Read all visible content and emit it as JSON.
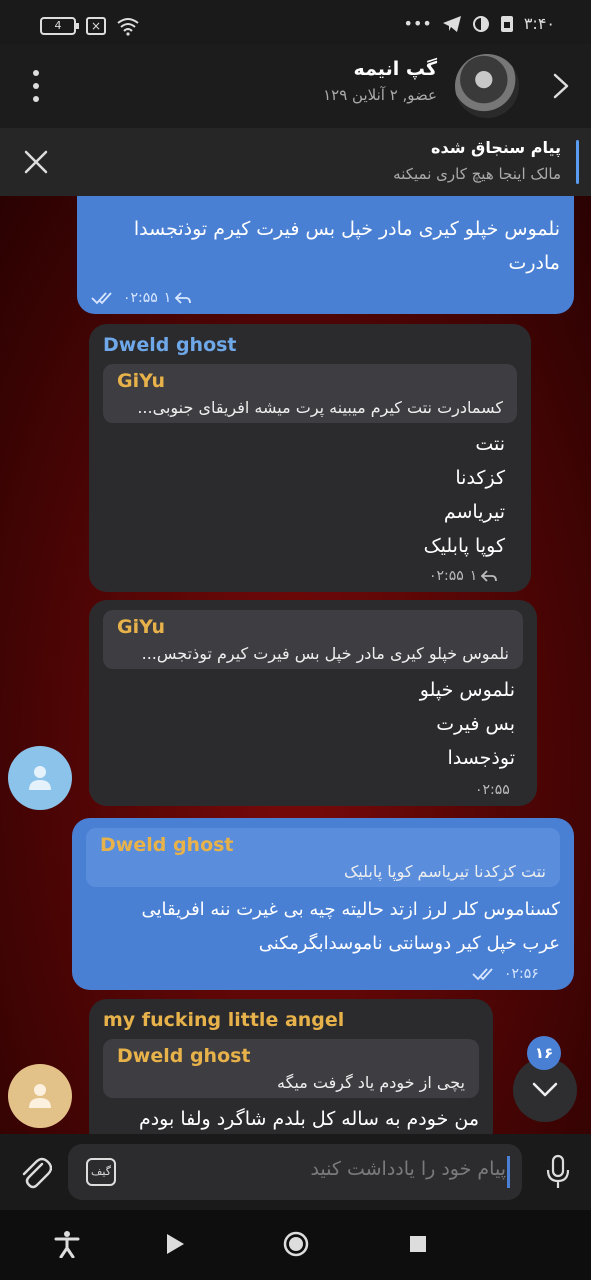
{
  "status_bar": {
    "battery": "4",
    "time": "۳:۴۰",
    "icons": [
      "battery-icon",
      "close-box-icon",
      "wifi-icon",
      "more-dots-icon",
      "telegram-icon",
      "circle-icon",
      "sim-icon"
    ]
  },
  "header": {
    "title": "گپ انیمه",
    "subtitle": "۱۲۹ عضو, ۲ آنلاین"
  },
  "pinned": {
    "title": "پیام سنجاق شده",
    "text": "مالک اینجا هیچ کاری نمیکنه"
  },
  "messages": [
    {
      "type": "outgoing",
      "lines": [
        "نلموس خپلو کیری مادر خپل بس فیرت کیرم توذتجسدا",
        "مادرت"
      ],
      "time": "۰۲:۵۵",
      "replies": "۱"
    },
    {
      "type": "incoming",
      "sender": "Dweld ghost",
      "reply_name": "GiYu",
      "reply_text": "کسمادرت نتت کیرم میبینه پرت میشه افریقای جنوبی...",
      "lines": [
        "نتت",
        "کزکدنا",
        "تیریاسم",
        "کوپا پابلیک"
      ],
      "time": "۰۲:۵۵",
      "replies": "۱"
    },
    {
      "type": "incoming",
      "reply_name": "GiYu",
      "reply_text": "نلموس خپلو کیری مادر خپل بس فیرت کیرم توذتجس...",
      "lines": [
        "نلموس خپلو",
        "بس فیرت",
        "توذجسدا"
      ],
      "time": "۰۲:۵۵"
    },
    {
      "type": "outgoing",
      "reply_name": "Dweld ghost",
      "reply_text": "نتت کزکدنا تیریاسم  کوپا پابلیک",
      "lines": [
        "کسناموس کلر لرز ازتد حالیته چیه بی غیرت ننه افریقایی",
        "عرب خپل کیر دوسانتی ناموسدابگرمکنی"
      ],
      "time": "۰۲:۵۶"
    },
    {
      "type": "incoming",
      "sender": "my fucking little angel",
      "reply_name": "Dweld ghost",
      "reply_text": "یچی از خودم یاد گرفت میگه",
      "lines": [
        "من خودم به ساله کل بلدم شاگرد ولفا بودم"
      ]
    }
  ],
  "unread_count": "۱۶",
  "input": {
    "placeholder": "پیام خود را یادداشت کنید",
    "gif_label": "گیف"
  },
  "colors": {
    "outgoing_bubble": "#4a80d4",
    "incoming_bubble": "#2b2b2e",
    "sender_blue": "#6fa8e8",
    "reply_gold": "#e8b24a"
  }
}
